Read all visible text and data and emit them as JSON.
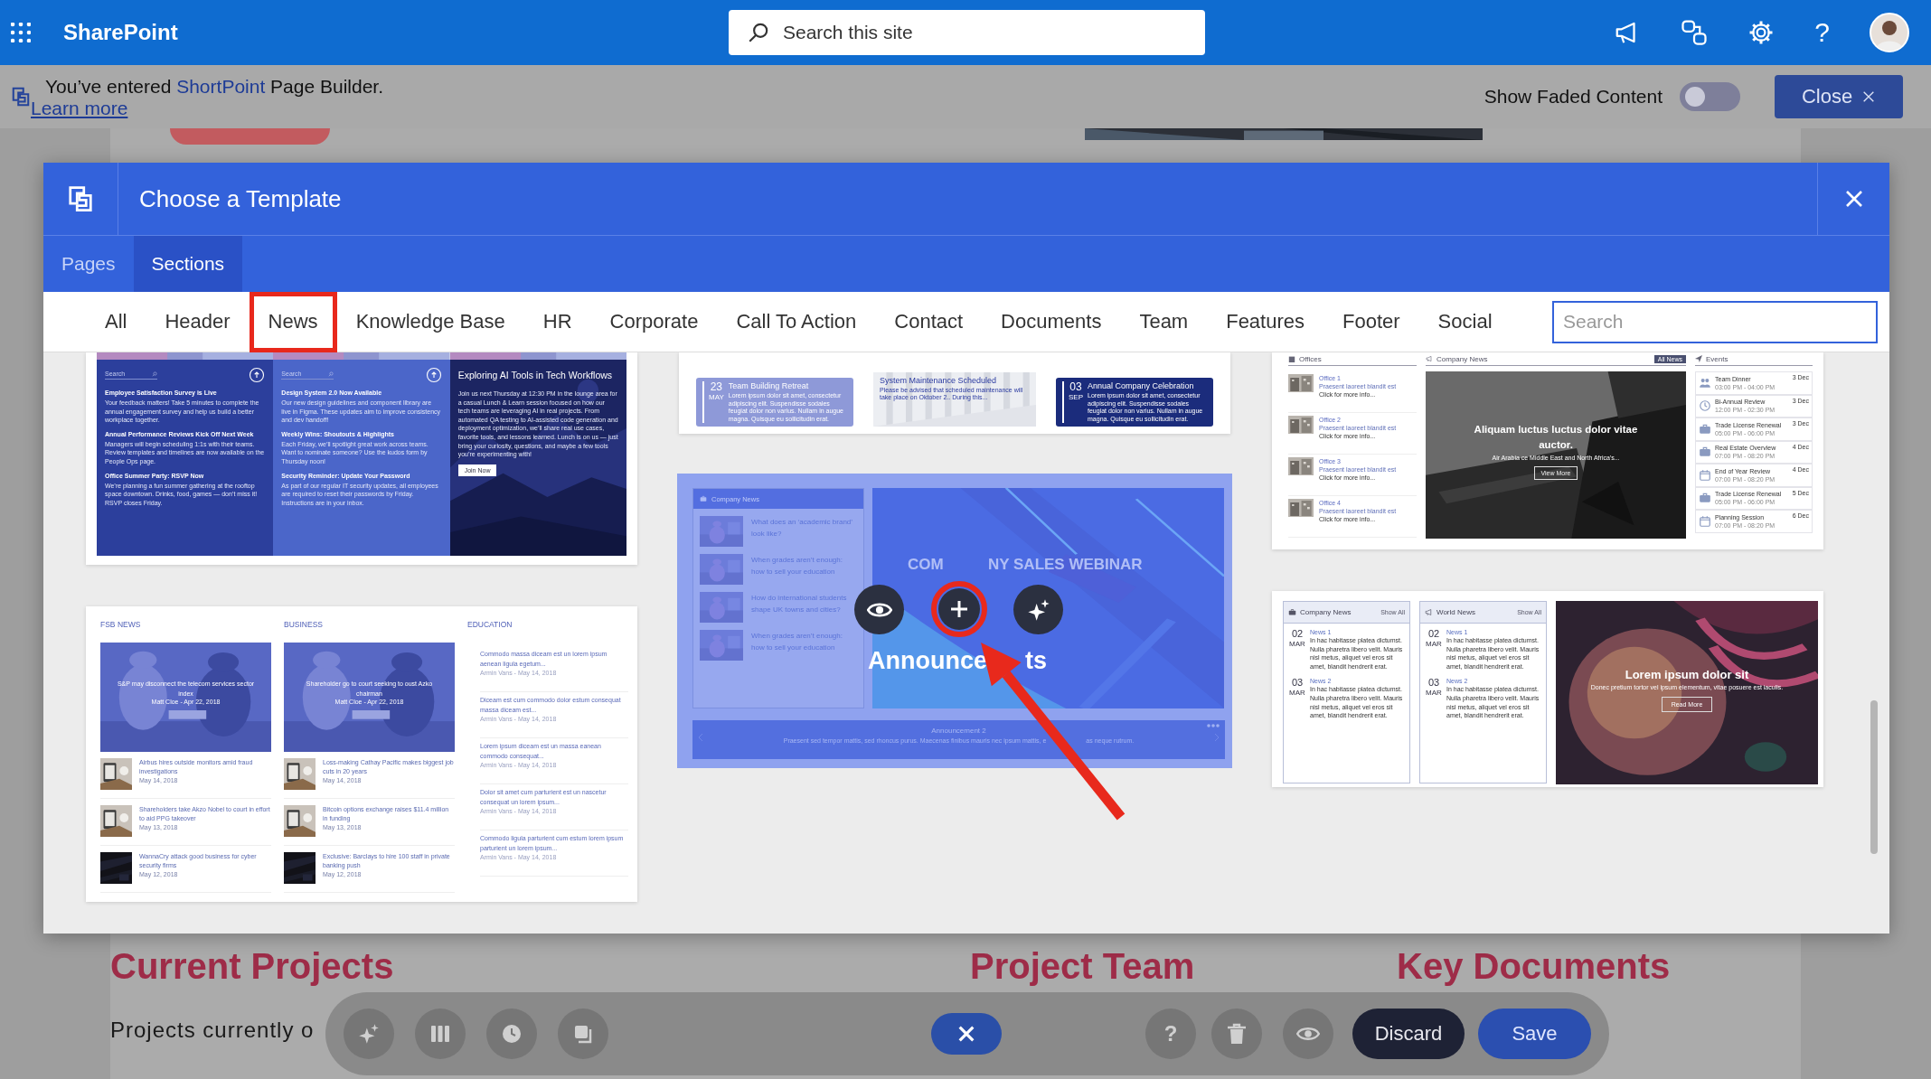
{
  "top_bar": {
    "app_name": "SharePoint",
    "search": {
      "placeholder": "Search this site"
    },
    "help": "?"
  },
  "notice": {
    "message": "You’ve entered **ShortPoint** Page Builder.",
    "link": "Learn more",
    "toggle": {
      "label": "Show Faded Content",
      "on": false
    },
    "close_button": "Close"
  },
  "back_page": {
    "headings": [
      "Current Projects",
      "Project Team",
      "Key Documents"
    ],
    "text": "Projects currently o"
  },
  "dialog": {
    "title": "Choose a Template",
    "tabs": [
      {
        "label": "Pages",
        "selected": false
      },
      {
        "label": "Sections",
        "selected": true
      }
    ],
    "categories": [
      {
        "label": "All",
        "highlighted": false
      },
      {
        "label": "Header",
        "highlighted": false
      },
      {
        "label": "News",
        "highlighted": true
      },
      {
        "label": "Knowledge Base",
        "highlighted": false
      },
      {
        "label": "HR",
        "highlighted": false
      },
      {
        "label": "Corporate",
        "highlighted": false
      },
      {
        "label": "Call To Action",
        "highlighted": false
      },
      {
        "label": "Contact",
        "highlighted": false
      },
      {
        "label": "Documents",
        "highlighted": false
      },
      {
        "label": "Team",
        "highlighted": false
      },
      {
        "label": "Features",
        "highlighted": false
      },
      {
        "label": "Footer",
        "highlighted": false
      },
      {
        "label": "Social",
        "highlighted": false
      }
    ],
    "search": {
      "placeholder": "Search"
    },
    "template_columns": [
      {
        "templates": [
          {
            "kind": "news-columns",
            "hovered": false,
            "columns": [
              {
                "search_placeholder": "Search",
                "items": [
                  {
                    "title": "Employee Satisfaction Survey is Live",
                    "body": "Your feedback matters! Take 5 minutes to complete the annual engagement survey and help us build a better workplace together."
                  },
                  {
                    "title": "Annual Performance Reviews Kick Off Next Week",
                    "body": "Managers will begin scheduling 1:1s with their teams. Review templates and timelines are now available on the People Ops page."
                  },
                  {
                    "title": "Office Summer Party: RSVP Now",
                    "body": "We’re planning a fun summer gathering at the rooftop space downtown. Drinks, food, games — don’t miss it! RSVP closes Friday."
                  }
                ]
              },
              {
                "search_placeholder": "Search",
                "items": [
                  {
                    "title": "Design System 2.0 Now Available",
                    "body": "Our new design guidelines and component library are live in Figma. These updates aim to improve consistency and dev handoff!"
                  },
                  {
                    "title": "Weekly Wins: Shoutouts & Highlights",
                    "body": "Each Friday, we’ll spotlight great work across teams. Want to nominate someone? Use the kudos form by Thursday noon!"
                  },
                  {
                    "title": "Security Reminder: Update Your Password",
                    "body": "As part of our regular IT security updates, all employees are required to reset their passwords by Friday. Instructions are in your inbox."
                  }
                ]
              }
            ],
            "feature": {
              "title": "Exploring AI Tools in Tech Workflows",
              "body": "Join us next Thursday at 12:30 PM in the lounge area for a casual Lunch & Learn session focused on how our tech teams are leveraging AI in real projects. From automated QA testing to AI-assisted code generation and deployment optimization, we’ll share real use cases, favorite tools, and lessons learned. Lunch is on us — just bring your curiosity, questions, and maybe a few tools you’re experimenting with!",
              "button": "Join Now"
            }
          },
          {
            "kind": "category-news",
            "hovered": false,
            "sections": [
              {
                "title": "FSB NEWS",
                "feature": {
                  "title": "S&P may disconnect the telecom services sector index",
                  "meta": "Matt Cloe - Apr 22, 2018"
                },
                "items": [
                  {
                    "title": "Airbus hires outside monitors amid fraud investigations",
                    "date": "May 14, 2018"
                  },
                  {
                    "title": "Shareholders take Akzo Nobel to court in effort to aid PPG takeover",
                    "date": "May 13, 2018"
                  },
                  {
                    "title": "WannaCry attack good business for cyber security firms",
                    "date": "May 12, 2018"
                  }
                ]
              },
              {
                "title": "BUSINESS",
                "feature": {
                  "title": "Shareholder go to court seeking to oust Azko chairman",
                  "meta": "Matt Cloe - Apr 22, 2018"
                },
                "items": [
                  {
                    "title": "Loss-making Cathay Pacific makes biggest job cuts in 20 years",
                    "date": "May 14, 2018"
                  },
                  {
                    "title": "Bitcoin options exchange raises $11.4 million in funding",
                    "date": "May 13, 2018"
                  },
                  {
                    "title": "Exclusive: Barclays to hire 100 staff in private banking push",
                    "date": "May 12, 2018"
                  }
                ]
              },
              {
                "title": "EDUCATION",
                "items": [
                  {
                    "title": "Commodo massa diceam est un lorem ipsum aenean ligula egetum...",
                    "date": "Armin Vans - May 14, 2018"
                  },
                  {
                    "title": "Diceam est cum commodo dolor estum consequat massa diceam est...",
                    "date": "Armin Vans - May 14, 2018"
                  },
                  {
                    "title": "Lorem ipsum diceam est un massa eanean commodo consequat...",
                    "date": "Armin Vans - May 14, 2018"
                  },
                  {
                    "title": "Dolor sit amet cum parturient est un nascetur consequat un lorem ipsum...",
                    "date": "Armin Vans - May 14, 2018"
                  },
                  {
                    "title": "Commodo ligula parturient cum estum lorem ipsum parturient un lorem ipsum...",
                    "date": "Armin Vans - May 14, 2018"
                  }
                ]
              }
            ]
          }
        ]
      },
      {
        "templates": [
          {
            "kind": "event-cards",
            "hovered": false,
            "events": [
              {
                "kind": "tinted",
                "day": "23",
                "month": "MAY",
                "title": "Team Building Retreat",
                "body": "Lorem ipsum dolor sit amet, consectetur adipiscing elit. Suspendisse sodales feugiat dolor non varius. Nullam in augue magna. Quisque eu sollicitudin erat."
              },
              {
                "title": "System Maintenance Scheduled",
                "body": "Please be advised that scheduled maintenance will take place on Oktober 2.. During this..."
              },
              {
                "kind": "dark",
                "day": "03",
                "month": "SEP",
                "title": "Annual Company Celebration",
                "body": "Lorem ipsum dolor sit amet, consectetur adipiscing elit. Suspendisse sodales feugiat dolor non varius. Nullam in augue magna. Quisque eu sollicitudin erat."
              }
            ]
          },
          {
            "kind": "news-banner",
            "hovered": true,
            "callout": true,
            "news": {
              "title": "Company News",
              "items": [
                {
                  "title": "What does an ‘academic brand’ look like?"
                },
                {
                  "title": "When grades aren’t enough: how to sell your education"
                },
                {
                  "title": "How do international students shape UK towns and cities?"
                },
                {
                  "title": "When grades aren’t enough: how to sell your education"
                }
              ]
            },
            "banner": {
              "title_parts": [
                "COM",
                "NY SALES WEBINAR"
              ],
              "heading_parts": [
                "Announce",
                "ts"
              ]
            },
            "announcement": {
              "title": "Announcement 2",
              "body_parts": [
                "Praesent sed tempor mattis, sed rhoncus purus. Maecenas finibus mauris nec ipsum mattis, e",
                "as neque rutrum."
              ]
            }
          }
        ]
      },
      {
        "templates": [
          {
            "kind": "offices-news-events",
            "hovered": false,
            "offices": {
              "title": "Offices",
              "items": [
                {
                  "name": "Office 1",
                  "subtitle": "Praesent laoreet blandit est",
                  "link": "Click for more info..."
                },
                {
                  "name": "Office 2",
                  "subtitle": "Praesent laoreet blandit est",
                  "link": "Click for more info..."
                },
                {
                  "name": "Office 3",
                  "subtitle": "Praesent laoreet blandit est",
                  "link": "Click for more info..."
                },
                {
                  "name": "Office 4",
                  "subtitle": "Praesent laoreet blandit est",
                  "link": "Click for more info..."
                }
              ]
            },
            "news": {
              "title": "Company News",
              "badge": "All News",
              "headline": "Aliquam luctus luctus dolor vitae auctor.",
              "caption": "Air Arabia ce Middle East and North Africa's...",
              "button": "View More"
            },
            "events": {
              "title": "Events",
              "items": [
                {
                  "kind": "people",
                  "name": "Team Dinner",
                  "time": "03:00 PM - 04:00 PM",
                  "date": "3 Dec"
                },
                {
                  "kind": "clock",
                  "name": "Bi-Annual Review",
                  "time": "12:00 PM - 02:30 PM",
                  "date": "3 Dec"
                },
                {
                  "kind": "briefcase",
                  "name": "Trade License Renewal",
                  "time": "05:00 PM - 06:00 PM",
                  "date": "3 Dec"
                },
                {
                  "kind": "briefcase",
                  "name": "Real Estate Overview",
                  "time": "07:00 PM - 08:20 PM",
                  "date": "4 Dec"
                },
                {
                  "kind": "calendar",
                  "name": "End of Year Review",
                  "time": "07:00 PM - 08:20 PM",
                  "date": "4 Dec"
                },
                {
                  "kind": "briefcase",
                  "name": "Trade License Renewal",
                  "time": "05:00 PM - 06:00 PM",
                  "date": "5 Dec"
                },
                {
                  "kind": "calendar",
                  "name": "Planning Session",
                  "time": "07:00 PM - 08:20 PM",
                  "date": "6 Dec"
                }
              ]
            }
          },
          {
            "kind": "news-feature",
            "hovered": false,
            "panels": [
              {
                "title": "Company News",
                "link": "Show All",
                "items": [
                  {
                    "day": "02",
                    "month": "MAR",
                    "title": "News 1",
                    "body": "In hac habitasse platea dictumst. Nulla pharetra libero velit. Mauris nisl metus, aliquet vel eros sit amet, blandit hendrerit erat."
                  },
                  {
                    "day": "03",
                    "month": "MAR",
                    "title": "News 2",
                    "body": "In hac habitasse platea dictumst. Nulla pharetra libero velit. Mauris nisl metus, aliquet vel eros sit amet, blandit hendrerit erat."
                  }
                ]
              },
              {
                "title": "World News",
                "link": "Show All",
                "items": [
                  {
                    "day": "02",
                    "month": "MAR",
                    "title": "News 1",
                    "body": "In hac habitasse platea dictumst. Nulla pharetra libero velit. Mauris nisl metus, aliquet vel eros sit amet, blandit hendrerit erat."
                  },
                  {
                    "day": "03",
                    "month": "MAR",
                    "title": "News 2",
                    "body": "In hac habitasse platea dictumst. Nulla pharetra libero velit. Mauris nisl metus, aliquet vel eros sit amet, blandit hendrerit erat."
                  }
                ]
              }
            ],
            "feature": {
              "title": "Lorem ipsum dolor sit",
              "body": "Donec pretium tortor vel ipsum elementum, vitae posuere est iaculis.",
              "button": "Read More"
            }
          }
        ]
      }
    ]
  },
  "toolbar": {
    "help": "?",
    "discard": "Discard",
    "save": "Save"
  }
}
